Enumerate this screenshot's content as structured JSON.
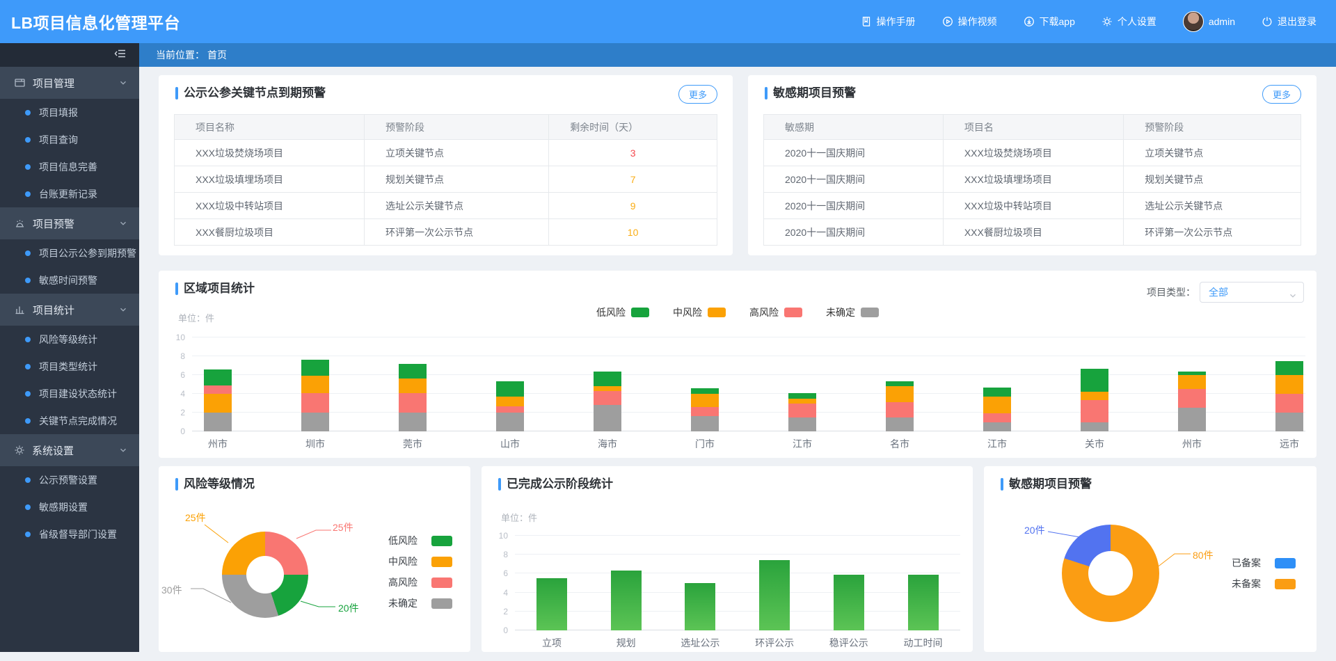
{
  "app": {
    "title": "LB项目信息化管理平台"
  },
  "header": {
    "nav": [
      {
        "icon": "manual-icon",
        "label": "操作手册"
      },
      {
        "icon": "video-icon",
        "label": "操作视频"
      },
      {
        "icon": "download-icon",
        "label": "下载app"
      },
      {
        "icon": "gear-icon",
        "label": "个人设置"
      },
      {
        "icon": "avatar",
        "label": "admin"
      },
      {
        "icon": "logout-icon",
        "label": "退出登录"
      }
    ]
  },
  "breadcrumb": {
    "prefix": "当前位置：",
    "current": "首页"
  },
  "sidebar": {
    "sections": [
      {
        "icon": "project-icon",
        "label": "项目管理",
        "children": [
          "项目填报",
          "项目查询",
          "项目信息完善",
          "台账更新记录"
        ]
      },
      {
        "icon": "alarm-icon",
        "label": "项目预警",
        "children": [
          "项目公示公参到期预警",
          "敏感时间预警"
        ]
      },
      {
        "icon": "stats-icon",
        "label": "项目统计",
        "children": [
          "风险等级统计",
          "项目类型统计",
          "项目建设状态统计",
          "关键节点完成情况"
        ]
      },
      {
        "icon": "gear-icon",
        "label": "系统设置",
        "children": [
          "公示预警设置",
          "敏感期设置",
          "省级督导部门设置"
        ]
      }
    ]
  },
  "colors": {
    "accent": "#3e9af9",
    "low": "#17a33d",
    "mid": "#fba105",
    "high": "#f97672",
    "unknown": "#9e9e9e",
    "filed": "#5273f0",
    "filed_legend": "#2e8ff7",
    "unfiled": "#fb9d13",
    "warn_red": "#f5484d",
    "warn_orange": "#faad14",
    "bar_green_top": "#2aa33c",
    "bar_green_bottom": "#5cc455"
  },
  "cards": {
    "node_warning": {
      "title": "公示公参关键节点到期预警",
      "more_label": "更多",
      "columns": [
        "项目名称",
        "预警阶段",
        "剩余时间（天）"
      ],
      "rows": [
        {
          "name": "XXX垃圾焚烧场项目",
          "stage": "立项关键节点",
          "days": "3",
          "days_color": "warn_red"
        },
        {
          "name": "XXX垃圾填埋场项目",
          "stage": "规划关键节点",
          "days": "7",
          "days_color": "warn_orange"
        },
        {
          "name": "XXX垃圾中转站项目",
          "stage": "选址公示关键节点",
          "days": "9",
          "days_color": "warn_orange"
        },
        {
          "name": "XXX餐厨垃圾项目",
          "stage": "环评第一次公示节点",
          "days": "10",
          "days_color": "warn_orange"
        }
      ]
    },
    "sensitive_warning": {
      "title": "敏感期项目预警",
      "more_label": "更多",
      "columns": [
        "敏感期",
        "项目名",
        "预警阶段"
      ],
      "rows": [
        [
          "2020十一国庆期间",
          "XXX垃圾焚烧场项目",
          "立项关键节点"
        ],
        [
          "2020十一国庆期间",
          "XXX垃圾填埋场项目",
          "规划关键节点"
        ],
        [
          "2020十一国庆期间",
          "XXX垃圾中转站项目",
          "选址公示关键节点"
        ],
        [
          "2020十一国庆期间",
          "XXX餐厨垃圾项目",
          "环评第一次公示节点"
        ]
      ]
    },
    "region": {
      "title": "区域项目统计",
      "unit_label": "单位：件",
      "filter": {
        "label": "项目类型：",
        "value": "全部"
      }
    },
    "risk": {
      "title": "风险等级情况"
    },
    "stage": {
      "title": "已完成公示阶段统计",
      "unit_label": "单位：件"
    },
    "filed": {
      "title": "敏感期项目预警"
    }
  },
  "chart_data": [
    {
      "type": "bar",
      "stacked": true,
      "title": "区域项目统计",
      "unit": "件",
      "ylim": [
        0,
        10
      ],
      "yticks": [
        0,
        2,
        4,
        6,
        8,
        10
      ],
      "grid": true,
      "legend_position": "top-center",
      "legend": [
        {
          "label": "低风险",
          "color_key": "low"
        },
        {
          "label": "中风险",
          "color_key": "mid"
        },
        {
          "label": "高风险",
          "color_key": "high"
        },
        {
          "label": "未确定",
          "color_key": "unknown"
        }
      ],
      "categories": [
        "州市",
        "圳市",
        "莞市",
        "山市",
        "海市",
        "门市",
        "江市",
        "名市",
        "江市",
        "关市",
        "州市",
        "远市"
      ],
      "bars": [
        {
          "category": "州市",
          "segments": [
            [
              "unknown",
              2.0
            ],
            [
              "mid",
              2.0
            ],
            [
              "high",
              0.9
            ],
            [
              "low",
              1.7
            ]
          ]
        },
        {
          "category": "圳市",
          "segments": [
            [
              "unknown",
              2.0
            ],
            [
              "high",
              2.1
            ],
            [
              "mid",
              1.8
            ],
            [
              "low",
              1.7
            ]
          ]
        },
        {
          "category": "莞市",
          "segments": [
            [
              "unknown",
              2.0
            ],
            [
              "high",
              2.1
            ],
            [
              "mid",
              1.5
            ],
            [
              "low",
              1.6
            ]
          ]
        },
        {
          "category": "山市",
          "segments": [
            [
              "unknown",
              2.0
            ],
            [
              "high",
              0.7
            ],
            [
              "mid",
              1.0
            ],
            [
              "low",
              1.6
            ]
          ]
        },
        {
          "category": "海市",
          "segments": [
            [
              "unknown",
              2.8
            ],
            [
              "high",
              1.5
            ],
            [
              "mid",
              0.5
            ],
            [
              "low",
              1.6
            ]
          ]
        },
        {
          "category": "门市",
          "segments": [
            [
              "unknown",
              1.6
            ],
            [
              "high",
              1.0
            ],
            [
              "mid",
              1.4
            ],
            [
              "low",
              0.6
            ]
          ]
        },
        {
          "category": "江市",
          "segments": [
            [
              "unknown",
              1.5
            ],
            [
              "high",
              1.5
            ],
            [
              "mid",
              0.5
            ],
            [
              "low",
              0.6
            ]
          ]
        },
        {
          "category": "名市",
          "segments": [
            [
              "unknown",
              1.5
            ],
            [
              "high",
              1.6
            ],
            [
              "mid",
              1.7
            ],
            [
              "low",
              0.5
            ]
          ]
        },
        {
          "category": "江市",
          "segments": [
            [
              "unknown",
              1.0
            ],
            [
              "high",
              0.9
            ],
            [
              "mid",
              1.8
            ],
            [
              "low",
              1.0
            ]
          ]
        },
        {
          "category": "关市",
          "segments": [
            [
              "unknown",
              1.0
            ],
            [
              "high",
              2.3
            ],
            [
              "mid",
              0.9
            ],
            [
              "low",
              2.5
            ]
          ]
        },
        {
          "category": "州市",
          "segments": [
            [
              "unknown",
              2.5
            ],
            [
              "high",
              2.0
            ],
            [
              "mid",
              1.5
            ],
            [
              "low",
              0.4
            ]
          ]
        },
        {
          "category": "远市",
          "segments": [
            [
              "unknown",
              2.0
            ],
            [
              "high",
              2.0
            ],
            [
              "mid",
              2.0
            ],
            [
              "low",
              1.5
            ]
          ]
        }
      ]
    },
    {
      "type": "pie",
      "donut": true,
      "title": "风险等级情况",
      "slices": [
        {
          "label": "高风险",
          "value": 25,
          "callout": "25件",
          "color_key": "high"
        },
        {
          "label": "低风险",
          "value": 20,
          "callout": "20件",
          "color_key": "low"
        },
        {
          "label": "未确定",
          "value": 30,
          "callout": "30件",
          "color_key": "unknown"
        },
        {
          "label": "中风险",
          "value": 25,
          "callout": "25件",
          "color_key": "mid"
        }
      ],
      "legend": [
        {
          "label": "低风险",
          "color_key": "low"
        },
        {
          "label": "中风险",
          "color_key": "mid"
        },
        {
          "label": "高风险",
          "color_key": "high"
        },
        {
          "label": "未确定",
          "color_key": "unknown"
        }
      ],
      "legend_position": "right"
    },
    {
      "type": "bar",
      "title": "已完成公示阶段统计",
      "unit": "件",
      "ylim": [
        0,
        10
      ],
      "yticks": [
        0,
        2,
        4,
        6,
        8,
        10
      ],
      "grid": true,
      "categories": [
        "立项",
        "规划",
        "选址公示",
        "环评公示",
        "稳评公示",
        "动工时间"
      ],
      "values": [
        5.5,
        6.3,
        5.0,
        7.4,
        5.9,
        5.9
      ]
    },
    {
      "type": "pie",
      "donut": true,
      "title": "敏感期项目预警",
      "slices": [
        {
          "label": "未备案",
          "value": 80,
          "callout": "80件",
          "color_key": "unfiled"
        },
        {
          "label": "已备案",
          "value": 20,
          "callout": "20件",
          "color_key": "filed"
        }
      ],
      "legend": [
        {
          "label": "已备案",
          "color_key": "filed_legend"
        },
        {
          "label": "未备案",
          "color_key": "unfiled"
        }
      ],
      "legend_position": "right"
    }
  ]
}
